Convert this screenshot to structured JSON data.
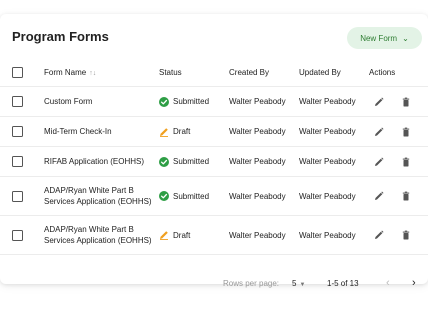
{
  "header": {
    "title": "Program Forms",
    "new_form_label": "New Form"
  },
  "columns": {
    "form_name": "Form Name",
    "status": "Status",
    "created_by": "Created By",
    "updated_by": "Updated By",
    "actions": "Actions"
  },
  "rows": [
    {
      "name": "Custom Form",
      "status": "Submitted",
      "created_by": "Walter Peabody",
      "updated_by": "Walter Peabody"
    },
    {
      "name": "Mid-Term Check-In",
      "status": "Draft",
      "created_by": "Walter Peabody",
      "updated_by": "Walter Peabody"
    },
    {
      "name": "RIFAB Application (EOHHS)",
      "status": "Submitted",
      "created_by": "Walter Peabody",
      "updated_by": "Walter Peabody"
    },
    {
      "name": "ADAP/Ryan White Part B Services Application (EOHHS)",
      "status": "Submitted",
      "created_by": "Walter Peabody",
      "updated_by": "Walter Peabody"
    },
    {
      "name": "ADAP/Ryan White Part B Services Application (EOHHS)",
      "status": "Draft",
      "created_by": "Walter Peabody",
      "updated_by": "Walter Peabody"
    }
  ],
  "pagination": {
    "rows_per_page_label": "Rows per page:",
    "rows_per_page": "5",
    "range": "1-5 of 13"
  },
  "colors": {
    "accent_green": "#2e7d32",
    "submitted_green": "#2e9e45",
    "draft_orange": "#f0a020",
    "button_bg": "#e3f3e6"
  }
}
